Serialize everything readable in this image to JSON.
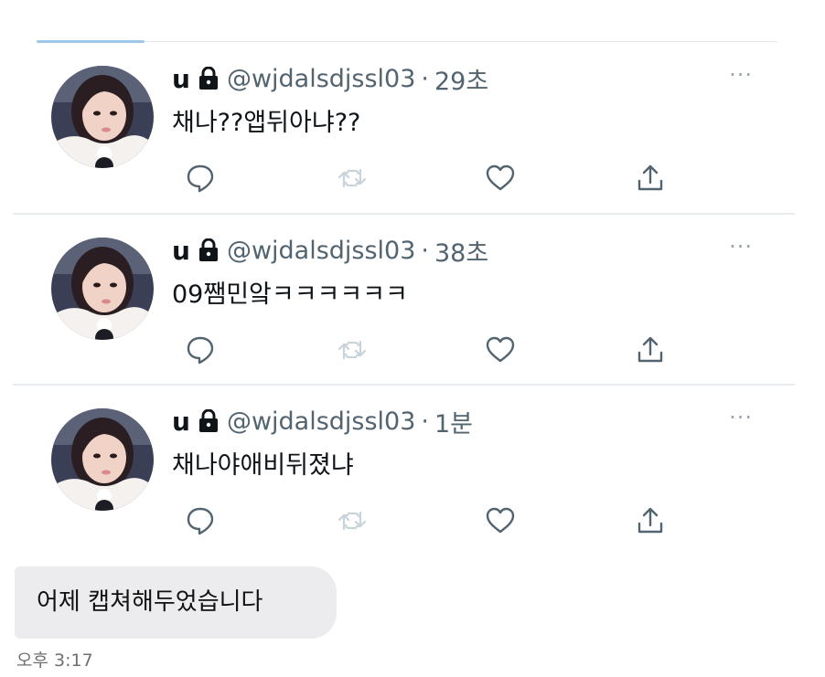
{
  "tweets": [
    {
      "name": "u",
      "handle": "@wjdalsdjssl03",
      "separator": "·",
      "time": "29초",
      "text": "채나??앱뒤아냐??",
      "more": "···"
    },
    {
      "name": "u",
      "handle": "@wjdalsdjssl03",
      "separator": "·",
      "time": "38초",
      "text": "09쨈민앜ㅋㅋㅋㅋㅋㅋ",
      "more": "···"
    },
    {
      "name": "u",
      "handle": "@wjdalsdjssl03",
      "separator": "·",
      "time": "1분",
      "text": "채나야애비뒤졌냐",
      "more": "···"
    }
  ],
  "icons": {
    "lock": "lock-icon",
    "reply": "reply-icon",
    "retweet": "retweet-icon",
    "like": "heart-icon",
    "share": "share-icon",
    "more": "more-icon"
  },
  "colors": {
    "name": "#0f1419",
    "meta": "#536471",
    "icon": "#536471",
    "retweet_disabled": "#c9d3da",
    "bubble_bg": "#ececee"
  },
  "message": {
    "text": "어제 캡쳐해두었습니다",
    "time": "오후 3:17"
  }
}
